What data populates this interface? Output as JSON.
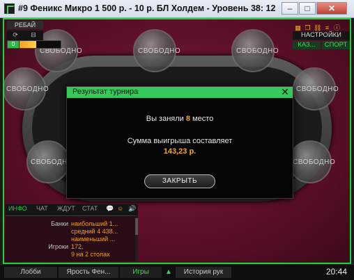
{
  "window": {
    "title": "#9 Феникс Микро 1 500 р. - 10 р. БЛ Холдем - Уровень 38: 125 00...",
    "min_label": "–",
    "max_label": "□",
    "close_label": "✕"
  },
  "rebuy": {
    "label": "РЕБАЙ",
    "count": "0"
  },
  "right_panel": {
    "settings_label": "НАСТРОЙКИ",
    "casino_label": "КАЗ...",
    "sport_label": "СПОРТ"
  },
  "seats": {
    "free_label": "СВОБОДНО"
  },
  "modal": {
    "title": "Результат турнира",
    "place_prefix": "Вы заняли ",
    "place_number": "8",
    "place_suffix": " место",
    "prize_text": "Сумма выигрыша составляет",
    "prize_amount": "143,23 р.",
    "close_button": "ЗАКРЫТЬ"
  },
  "info_panel": {
    "tabs": [
      "ИНФО",
      "ЧАТ",
      "ЖДУТ",
      "СТАТ"
    ],
    "rows": [
      {
        "label": "Банки",
        "value": "наибольший 1..."
      },
      {
        "label": "",
        "value": "средний 4 438..."
      },
      {
        "label": "",
        "value": "наименьший ..."
      },
      {
        "label": "Игроки",
        "value": "172,"
      },
      {
        "label": "",
        "value": "9 на 2 столах"
      }
    ]
  },
  "bottombar": {
    "lobby": "Лобби",
    "tournament_tab": "Ярость Фен...",
    "games": "Игры",
    "history": "История рук",
    "clock": "20:44"
  },
  "colors": {
    "accent_green": "#1fd33a",
    "highlight_orange": "#f2a818",
    "felt_red": "#5a0f27"
  }
}
